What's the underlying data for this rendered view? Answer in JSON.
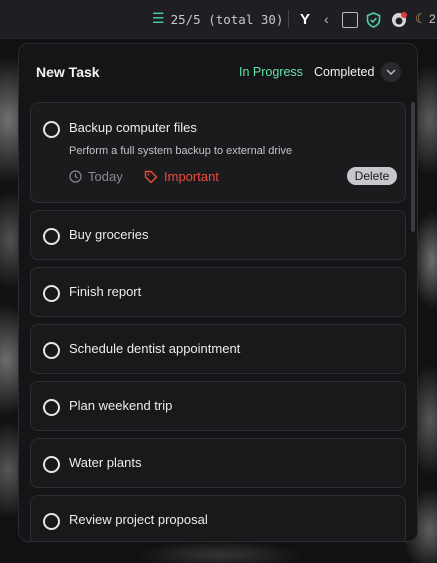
{
  "toolbar": {
    "stats": "25/5 (total 30)",
    "ext_letter": "Y",
    "trailing_text": "2"
  },
  "panel": {
    "title": "New Task",
    "tabs": [
      {
        "label": "In Progress",
        "active": true,
        "color": "#5fe3a8"
      },
      {
        "label": "Completed",
        "active": false
      }
    ]
  },
  "tasks": [
    {
      "title": "Backup computer files",
      "description": "Perform a full system backup to external drive",
      "due": "Today",
      "priority": "Important",
      "priority_color": "#ef4a3c",
      "action": "Delete",
      "expanded": true
    },
    {
      "title": "Buy groceries"
    },
    {
      "title": "Finish report"
    },
    {
      "title": "Schedule dentist appointment"
    },
    {
      "title": "Plan weekend trip"
    },
    {
      "title": "Water plants"
    },
    {
      "title": "Review project proposal"
    }
  ]
}
